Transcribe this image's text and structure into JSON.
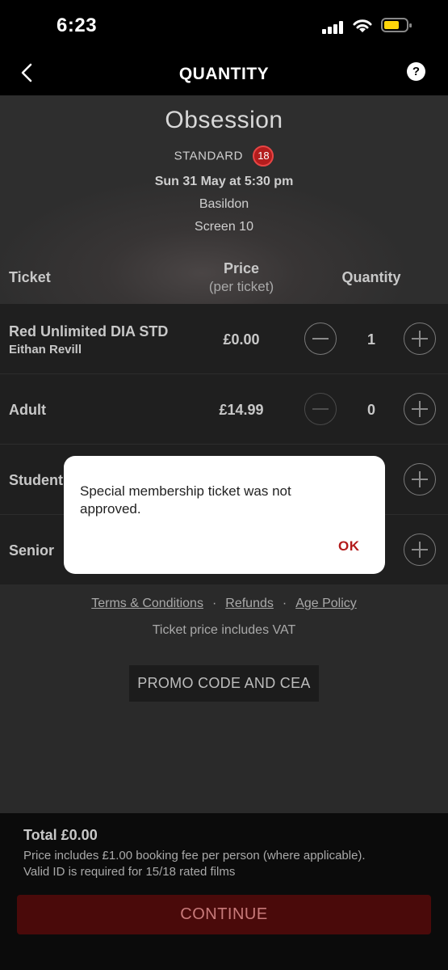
{
  "status_bar": {
    "time": "6:23"
  },
  "nav": {
    "title": "QUANTITY",
    "help_label": "?"
  },
  "movie": {
    "title": "Obsession",
    "format": "STANDARD",
    "rating": "18",
    "datetime": "Sun 31 May at 5:30 pm",
    "location": "Basildon",
    "screen": "Screen 10"
  },
  "table": {
    "headers": {
      "ticket": "Ticket",
      "price": "Price",
      "price_sub": "(per ticket)",
      "quantity": "Quantity"
    },
    "rows": [
      {
        "name": "Red Unlimited DIA STD",
        "subtitle": "Eithan Revill",
        "price": "£0.00",
        "quantity": "1"
      },
      {
        "name": "Adult",
        "subtitle": "",
        "price": "£14.99",
        "quantity": "0"
      },
      {
        "name": "Student",
        "subtitle": "",
        "price": "",
        "quantity": ""
      },
      {
        "name": "Senior",
        "subtitle": "",
        "price": "",
        "quantity": ""
      }
    ]
  },
  "links": {
    "terms": "Terms & Conditions",
    "refunds": "Refunds",
    "age_policy": "Age Policy",
    "separator": "·"
  },
  "vat_note": "Ticket price includes VAT",
  "promo_button": "PROMO CODE AND CEA",
  "footer": {
    "total": "Total £0.00",
    "note_line1": "Price includes £1.00 booking fee per person (where applicable).",
    "note_line2": "Valid ID is required for 15/18 rated films",
    "continue_label": "CONTINUE"
  },
  "dialog": {
    "message": "Special membership ticket was not approved.",
    "ok_label": "OK"
  },
  "colors": {
    "accent": "#b31b1b",
    "rating_badge": "#b31d1d",
    "battery": "#ffd60a"
  }
}
